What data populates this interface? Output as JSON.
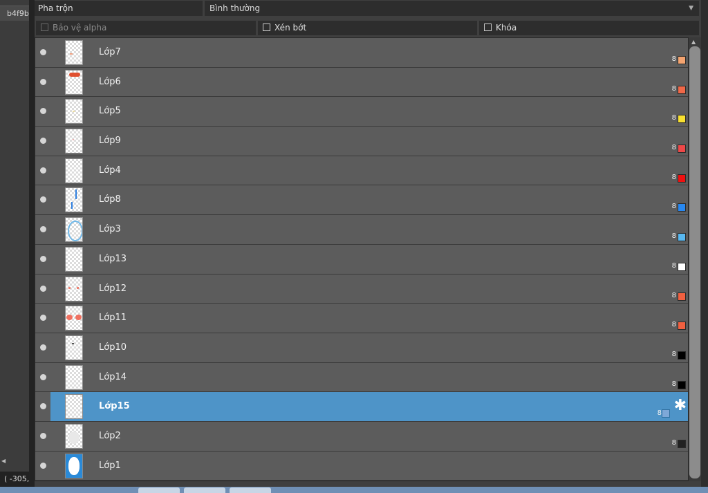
{
  "left_panel": {
    "tab_label": "b4f9b",
    "coordinates": "( -305,"
  },
  "blend": {
    "label": "Pha trộn",
    "mode": "Bình thường"
  },
  "options": {
    "protect_alpha": "Bảo vệ alpha",
    "clip": "Xén bớt",
    "lock": "Khóa"
  },
  "layers": [
    {
      "name": "Lớp7",
      "opacity": "8",
      "color": "#f4a470"
    },
    {
      "name": "Lớp6",
      "opacity": "8",
      "color": "#f06848"
    },
    {
      "name": "Lớp5",
      "opacity": "8",
      "color": "#f8e030"
    },
    {
      "name": "Lớp9",
      "opacity": "8",
      "color": "#ee4848"
    },
    {
      "name": "Lớp4",
      "opacity": "8",
      "color": "#f01010"
    },
    {
      "name": "Lớp8",
      "opacity": "8",
      "color": "#2888f0"
    },
    {
      "name": "Lớp3",
      "opacity": "8",
      "color": "#58b8f0"
    },
    {
      "name": "Lớp13",
      "opacity": "8",
      "color": "#ffffff"
    },
    {
      "name": "Lớp12",
      "opacity": "8",
      "color": "#f06040"
    },
    {
      "name": "Lớp11",
      "opacity": "8",
      "color": "#f06040"
    },
    {
      "name": "Lớp10",
      "opacity": "8",
      "color": "#000000"
    },
    {
      "name": "Lớp14",
      "opacity": "8",
      "color": "#000000"
    },
    {
      "name": "Lớp15",
      "opacity": "8",
      "color": "#7ea8d8",
      "selected": true,
      "icon": "gear-icon"
    },
    {
      "name": "Lớp2",
      "opacity": "8",
      "color": "#222222"
    },
    {
      "name": "Lớp1",
      "opacity": "",
      "color": ""
    }
  ],
  "colors": {
    "selection": "#4e94c8",
    "row_bg": "#5c5c5c"
  }
}
